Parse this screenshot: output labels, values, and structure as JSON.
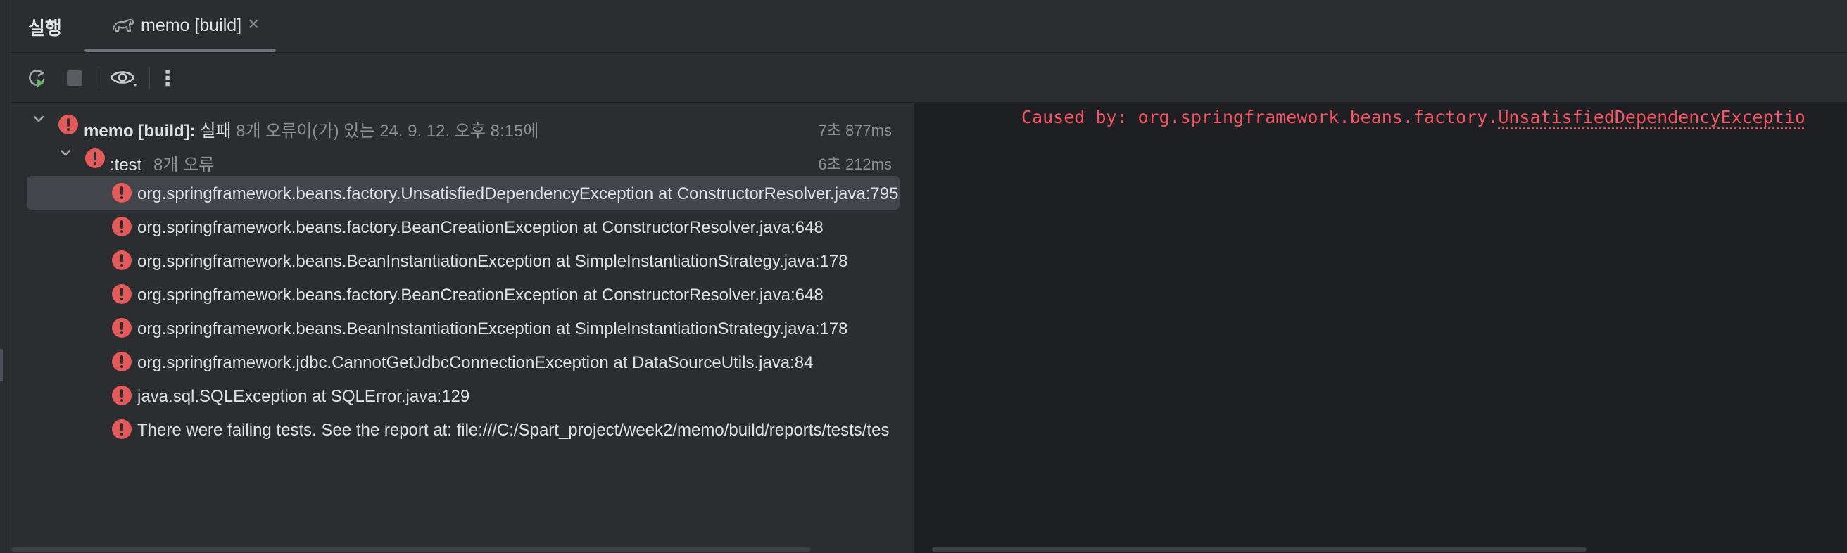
{
  "tabbar": {
    "run_title": "실행",
    "tab_label": "memo [build]",
    "tab_close": "×"
  },
  "toolbar": {
    "icons": [
      "rerun-icon",
      "stop-icon",
      "eye-icon",
      "more-vertical-icon"
    ],
    "more_glyph": "⋮"
  },
  "tree": {
    "root": {
      "name": "memo [build]:",
      "status": "실패",
      "detail": "8개 오류이(가) 있는 24. 9. 12. 오후 8:15에",
      "time": "7초 877ms"
    },
    "test": {
      "name": ":test",
      "detail": "8개 오류",
      "time": "6초 212ms"
    },
    "errors": [
      "org.springframework.beans.factory.UnsatisfiedDependencyException at ConstructorResolver.java:795",
      "org.springframework.beans.factory.BeanCreationException at ConstructorResolver.java:648",
      "org.springframework.beans.BeanInstantiationException at SimpleInstantiationStrategy.java:178",
      "org.springframework.beans.factory.BeanCreationException at ConstructorResolver.java:648",
      "org.springframework.beans.BeanInstantiationException at SimpleInstantiationStrategy.java:178",
      "org.springframework.jdbc.CannotGetJdbcConnectionException at DataSourceUtils.java:84",
      "java.sql.SQLException at SQLError.java:129",
      "There were failing tests. See the report at: file:///C:/Spart_project/week2/memo/build/reports/tests/tes"
    ]
  },
  "console": {
    "prefix": "Caused by: org.springframework.beans.factory.",
    "link": "UnsatisfiedDependencyExceptio"
  },
  "colors": {
    "background": "#2b2d30",
    "console_bg": "#1e1f22",
    "error": "#e25a5a",
    "console_error": "#f75464",
    "selection": "#43454a"
  }
}
